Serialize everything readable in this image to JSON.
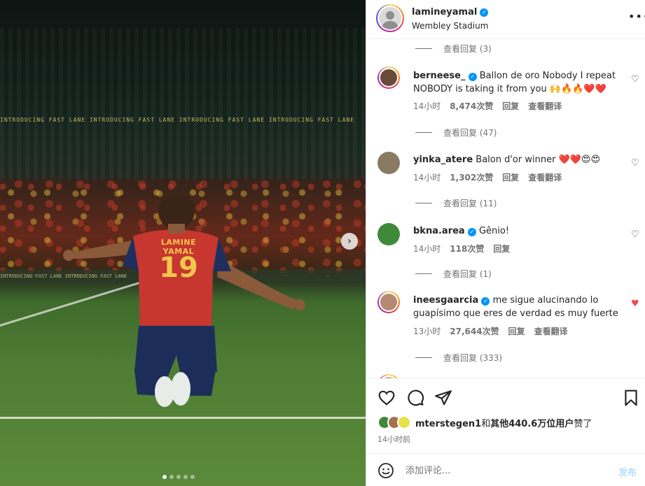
{
  "photo": {
    "led_text": "INTRODUCING FAST LANE   INTRODUCING FAST LANE   INTRODUCING FAST LANE   INTRODUCING FAST LANE",
    "board_text": "INTRODUCING FAST LANE   INTRODUCING FAST LANE",
    "shirt_name": "LAMINE YAMAL",
    "shirt_number": "19",
    "next_icon": "chevron-right-icon",
    "slides": 5,
    "active_slide": 1
  },
  "header": {
    "username": "lamineyamal",
    "location": "Wembley Stadium",
    "more_icon": "more-horizontal-icon"
  },
  "comments": {
    "top_view_replies": "查看回复 (3)",
    "items": [
      {
        "user": "berneese_",
        "verified": true,
        "text": "Ballon de oro Nobody I repeat NOBODY is taking it from you 🙌🔥🔥❤️❤️",
        "time": "14小时",
        "likes": "8,474次赞",
        "reply": "回复",
        "translate": "查看翻译",
        "view_replies": "查看回复 (47)",
        "liked": false,
        "avatar_color": "#6b4a3a"
      },
      {
        "user": "yinka_atere",
        "verified": false,
        "text": "Balon d'or winner ❤️❤️😍😍",
        "time": "14小时",
        "likes": "1,302次赞",
        "reply": "回复",
        "translate": "查看翻译",
        "view_replies": "查看回复 (11)",
        "liked": false,
        "avatar_color": "#8a7a62"
      },
      {
        "user": "bkna.area",
        "verified": true,
        "text": "Gênio!",
        "time": "14小时",
        "likes": "118次赞",
        "reply": "回复",
        "translate": "",
        "view_replies": "查看回复 (1)",
        "liked": false,
        "avatar_color": "#3f8a3a"
      },
      {
        "user": "ineesgaarcia",
        "verified": true,
        "text": "me sigue alucinando lo guapísimo que eres de verdad es muy fuerte",
        "time": "13小时",
        "likes": "27,644次赞",
        "reply": "回复",
        "translate": "查看翻译",
        "view_replies": "查看回复 (333)",
        "liked": true,
        "avatar_color": "#b58a70"
      }
    ]
  },
  "actions": {
    "like_icon": "heart-outline-icon",
    "comment_icon": "comment-icon",
    "share_icon": "paper-plane-icon",
    "save_icon": "bookmark-icon",
    "likes_user": "mterstegen1",
    "likes_connector": "和",
    "likes_others": "其他440.6万位用户",
    "likes_suffix": "赞了",
    "time": "14小时前",
    "emoji_icon": "smiley-icon",
    "comment_placeholder": "添加评论...",
    "post_label": "发布"
  },
  "colors": {
    "accent_blue": "#0095f6",
    "like_red": "#ed4956",
    "muted_text": "#737373",
    "post_disabled": "#b2dffc"
  }
}
